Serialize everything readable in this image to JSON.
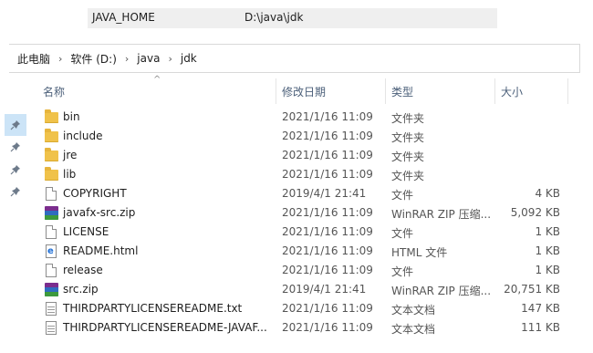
{
  "env": {
    "name": "JAVA_HOME",
    "value": "D:\\java\\jdk"
  },
  "breadcrumb": [
    "此电脑",
    "软件 (D:)",
    "java",
    "jdk"
  ],
  "breadcrumb_separator": "›",
  "columns": {
    "name": "名称",
    "date": "修改日期",
    "type": "类型",
    "size": "大小"
  },
  "sort_indicator": "^",
  "pins": [
    {
      "icon": "pin-icon"
    },
    {
      "icon": "pin-icon"
    },
    {
      "icon": "pin-icon"
    },
    {
      "icon": "pin-icon"
    }
  ],
  "files": [
    {
      "icon": "folder-icon",
      "name": "bin",
      "date": "2021/1/16 11:09",
      "type": "文件夹",
      "size": ""
    },
    {
      "icon": "folder-icon",
      "name": "include",
      "date": "2021/1/16 11:09",
      "type": "文件夹",
      "size": ""
    },
    {
      "icon": "folder-icon",
      "name": "jre",
      "date": "2021/1/16 11:09",
      "type": "文件夹",
      "size": ""
    },
    {
      "icon": "folder-icon",
      "name": "lib",
      "date": "2021/1/16 11:09",
      "type": "文件夹",
      "size": ""
    },
    {
      "icon": "file-icon",
      "name": "COPYRIGHT",
      "date": "2019/4/1 21:41",
      "type": "文件",
      "size": "4 KB"
    },
    {
      "icon": "winrar-zip-icon",
      "name": "javafx-src.zip",
      "date": "2021/1/16 11:09",
      "type": "WinRAR ZIP 压缩...",
      "size": "5,092 KB"
    },
    {
      "icon": "file-icon",
      "name": "LICENSE",
      "date": "2021/1/16 11:09",
      "type": "文件",
      "size": "1 KB"
    },
    {
      "icon": "html-file-icon",
      "name": "README.html",
      "date": "2021/1/16 11:09",
      "type": "HTML 文件",
      "size": "1 KB"
    },
    {
      "icon": "file-icon",
      "name": "release",
      "date": "2021/1/16 11:09",
      "type": "文件",
      "size": "1 KB"
    },
    {
      "icon": "winrar-zip-icon",
      "name": "src.zip",
      "date": "2019/4/1 21:41",
      "type": "WinRAR ZIP 压缩...",
      "size": "20,751 KB"
    },
    {
      "icon": "text-file-icon",
      "name": "THIRDPARTYLICENSEREADME.txt",
      "date": "2021/1/16 11:09",
      "type": "文本文档",
      "size": "147 KB"
    },
    {
      "icon": "text-file-icon",
      "name": "THIRDPARTYLICENSEREADME-JAVAF...",
      "date": "2021/1/16 11:09",
      "type": "文本文档",
      "size": "111 KB"
    }
  ]
}
